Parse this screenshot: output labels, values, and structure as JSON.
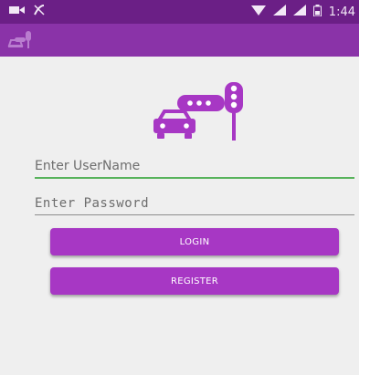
{
  "status_bar": {
    "time": "1:44"
  },
  "form": {
    "username_placeholder": "Enter UserName",
    "password_placeholder": "Enter Password"
  },
  "buttons": {
    "login": "LOGIN",
    "register": "REGISTER"
  },
  "colors": {
    "status_bar": "#6b1f86",
    "app_bar": "#8a33a8",
    "accent": "#a737c4",
    "field_focus": "#58b35c"
  },
  "icons": {
    "appbar": "car-traffic-light-icon",
    "logo": "car-traffic-light-icon"
  }
}
